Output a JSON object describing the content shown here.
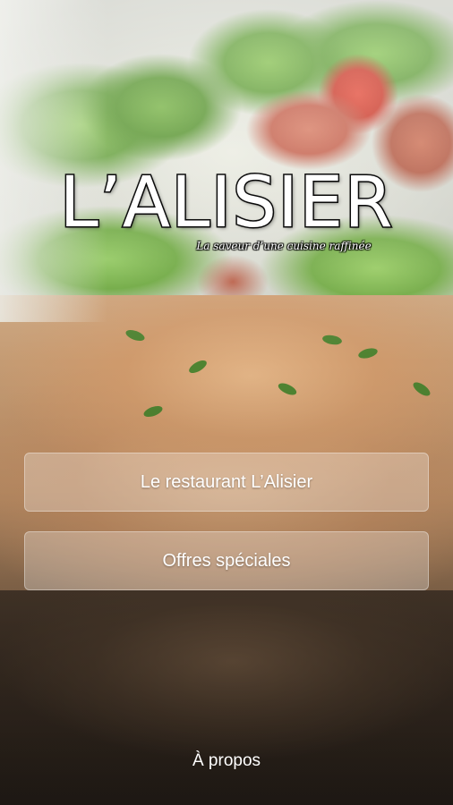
{
  "app": {
    "brand_name": "L’ALISIER",
    "tagline": "La saveur d’une cuisine raffinée"
  },
  "menu": {
    "items": [
      {
        "label": "Le restaurant L’Alisier"
      },
      {
        "label": "Offres spéciales"
      }
    ]
  },
  "footer": {
    "about_label": "À propos"
  },
  "colors": {
    "text": "#ffffff",
    "logo_outline": "#111111",
    "button_fill": "rgba(255,255,255,0.28)"
  }
}
